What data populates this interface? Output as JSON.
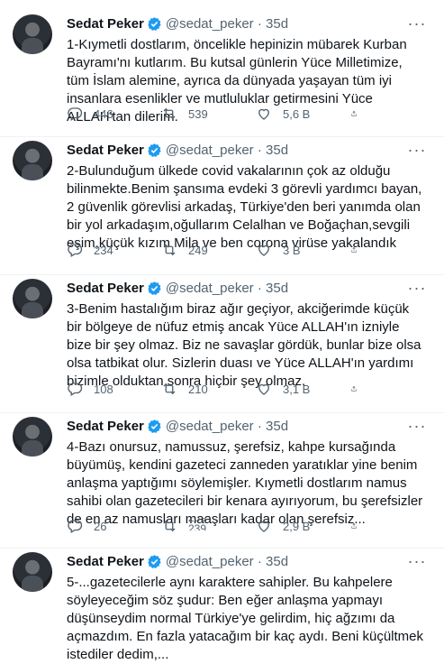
{
  "tweets": [
    {
      "name": "Sedat Peker",
      "handle": "@sedat_peker · 35d",
      "text": "1-Kıymetli dostlarım, öncelikle hepinizin mübarek Kurban Bayramı'nı kutlarım. Bu kutsal günlerin Yüce Milletimize, tüm İslam alemine, ayrıca da dünyada yaşayan tüm iyi insanlara esenlikler ve mutluluklar getirmesini Yüce ALLAH'tan dilerim.",
      "replies": "446",
      "retweets": "539",
      "likes": "5,6 B"
    },
    {
      "name": "Sedat Peker",
      "handle": "@sedat_peker · 35d",
      "text": "2-Bulunduğum ülkede covid vakalarının çok az olduğu bilinmekte.Benim şansıma evdeki 3 görevli yardımcı bayan, 2 güvenlik görevlisi arkadaş, Türkiye'den beri yanımda olan bir yol arkadaşım,oğullarım Celalhan ve Boğaçhan,sevgili eşim,küçük kızım Mila ve ben corona virüse yakalandık",
      "replies": "234",
      "retweets": "249",
      "likes": "3 B"
    },
    {
      "name": "Sedat Peker",
      "handle": "@sedat_peker · 35d",
      "text": "3-Benim hastalığım biraz ağır geçiyor, akciğerimde küçük bir bölgeye de nüfuz etmiş ancak Yüce ALLAH'ın izniyle bize bir şey olmaz. Biz ne savaşlar gördük, bunlar bize olsa olsa tatbikat olur. Sizlerin duası ve Yüce ALLAH'ın yardımı bizimle olduktan sonra hiçbir şey olmaz.",
      "replies": "108",
      "retweets": "210",
      "likes": "3,1 B"
    },
    {
      "name": "Sedat Peker",
      "handle": "@sedat_peker · 35d",
      "text": "4-Bazı onursuz, namussuz, şerefsiz, kahpe kursağında büyümüş, kendini gazeteci zanneden yaratıklar yine benim anlaşma yaptığımı söylemişler. Kıymetli dostlarım namus sahibi olan gazetecileri bir kenara ayırıyorum, bu şerefsizler de en az namusları maaşları kadar olan şerefsiz...",
      "replies": "26",
      "retweets_old": "239",
      "retweets": "239",
      "likes": "2,9 B"
    },
    {
      "name": "Sedat Peker",
      "handle": "@sedat_peker · 35d",
      "text": "5-...gazetecilerle aynı karaktere sahipler. Bu kahpelere söyleyeceğim söz şudur: Ben eğer anlaşma yapmayı düşünseydim normal Türkiye'ye gelirdim, hiç ağzımı da açmazdım. En fazla yatacağım bir kaç aydı. Beni küçültmek istediler dedim,..."
    }
  ],
  "more_icon": "more-horizontal-icon",
  "colors": {
    "verified": "#1d9bf0",
    "muted": "#536471",
    "text": "#0f1419"
  }
}
